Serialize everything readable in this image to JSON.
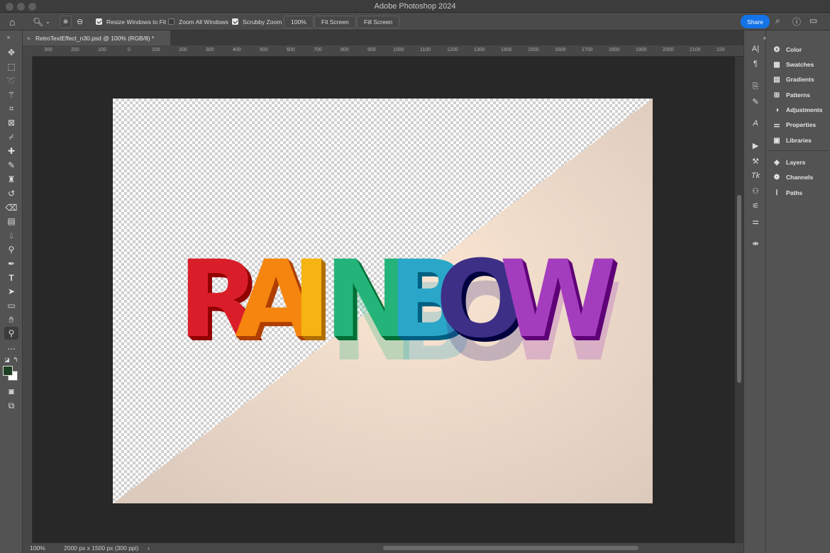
{
  "app": {
    "window_title": "Adobe Photoshop 2024"
  },
  "options_bar": {
    "resize_windows_label": "Resize Windows to Fit",
    "resize_windows_checked": true,
    "zoom_all_label": "Zoom All Windows",
    "zoom_all_checked": false,
    "scrubby_zoom_label": "Scrubby Zoom",
    "scrubby_zoom_checked": true,
    "zoom_value": "100%",
    "fit_screen_label": "Fit Screen",
    "fill_screen_label": "Fill Screen",
    "share_label": "Share"
  },
  "document_tab": {
    "title": "RetroTextEffect_n30.psd @ 100% (RGB/8) *"
  },
  "ruler": {
    "h_labels": [
      "300",
      "200",
      "100",
      "0",
      "100",
      "200",
      "300",
      "400",
      "500",
      "600",
      "700",
      "800",
      "900",
      "1000",
      "1100",
      "1200",
      "1300",
      "1400",
      "1500",
      "1600",
      "1700",
      "1800",
      "1900",
      "2000",
      "2100",
      "220"
    ]
  },
  "canvas": {
    "text": "RAINBOW",
    "letter_colors": [
      "#d91e2a",
      "#f5850f",
      "#f6b412",
      "#24b47a",
      "#2aa6c8",
      "#3c2f85",
      "#a43dbd"
    ],
    "background_color": "#f1e3d5"
  },
  "status": {
    "zoom": "100%",
    "doc_info": "2000 px x 1500 px (300 ppi)"
  },
  "panels": {
    "items": [
      {
        "label": "Color",
        "icon": "color-icon"
      },
      {
        "label": "Swatches",
        "icon": "swatches-icon"
      },
      {
        "label": "Gradients",
        "icon": "gradients-icon"
      },
      {
        "label": "Patterns",
        "icon": "patterns-icon"
      },
      {
        "label": "Adjustments",
        "icon": "adjustments-icon"
      },
      {
        "label": "Properties",
        "icon": "properties-icon"
      },
      {
        "label": "Libraries",
        "icon": "libraries-icon"
      },
      {
        "label": "Layers",
        "icon": "layers-icon"
      },
      {
        "label": "Channels",
        "icon": "channels-icon"
      },
      {
        "label": "Paths",
        "icon": "paths-icon"
      }
    ]
  },
  "colors": {
    "foreground": "#1f3f22",
    "background": "#ffffff",
    "accent": "#1473e6"
  }
}
